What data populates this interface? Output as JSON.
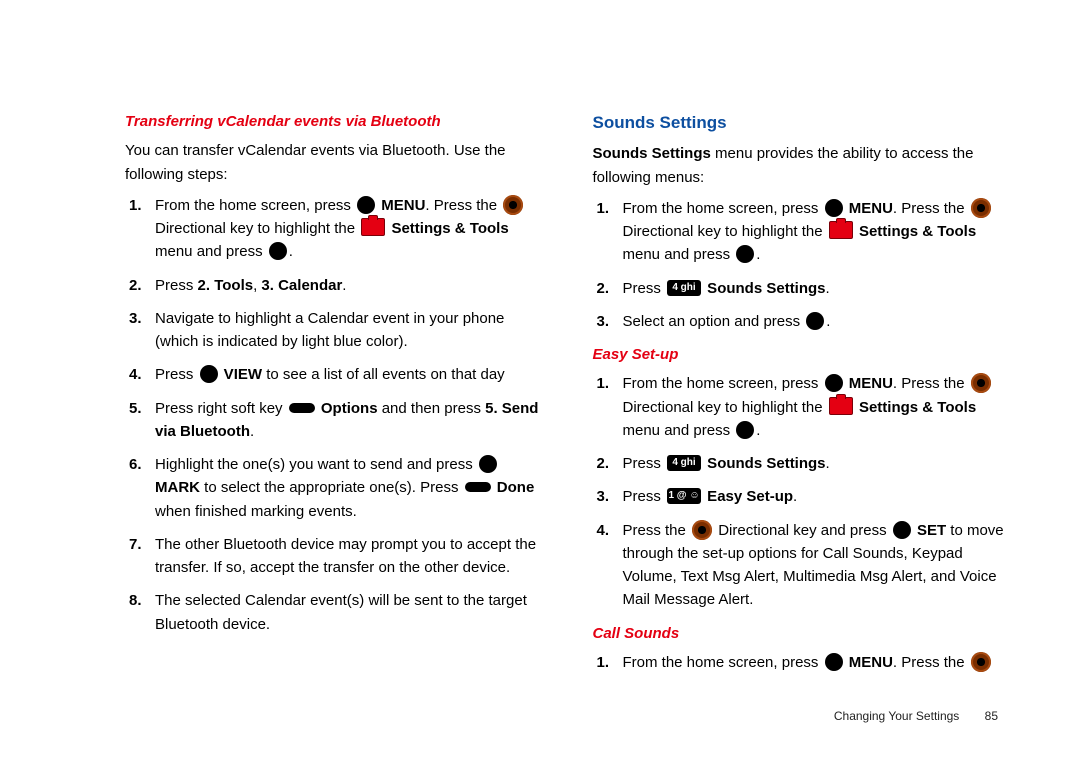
{
  "left": {
    "heading": "Transferring vCalendar events via Bluetooth",
    "intro": "You can transfer vCalendar events via Bluetooth. Use the following steps:",
    "s1_a": "From the home screen, press ",
    "s1_menu": " MENU",
    "s1_b": ". Press the ",
    "s1_c": "Directional key to highlight the ",
    "s1_tools": " Settings & Tools",
    "s1_d": " menu and press ",
    "s1_e": ".",
    "s2_a": "Press ",
    "s2_b": "2. Tools",
    "s2_c": ", ",
    "s2_d": "3. Calendar",
    "s2_e": ".",
    "s3": "Navigate to highlight a Calendar event in your phone (which is indicated by light blue color).",
    "s4_a": "Press ",
    "s4_view": " VIEW",
    "s4_b": " to see a list of all events on that day",
    "s5_a": "Press right soft key ",
    "s5_opt": " Options",
    "s5_b": " and then press ",
    "s5_c": "5. Send via Bluetooth",
    "s5_d": ".",
    "s6_a": "Highlight the one(s) you want to send and press ",
    "s6_mark": " MARK",
    "s6_b": " to select the appropriate one(s). Press ",
    "s6_done": " Done",
    "s6_c": " when finished marking events.",
    "s7": "The other Bluetooth device may prompt you to accept the transfer. If so, accept the transfer on the other device.",
    "s8": "The selected Calendar event(s) will be sent to the target Bluetooth device."
  },
  "right": {
    "heading": "Sounds Settings",
    "intro_a": "Sounds Settings",
    "intro_b": " menu provides the ability to access the following menus:",
    "s1_a": "From the home screen, press ",
    "s1_menu": " MENU",
    "s1_b": ". Press the ",
    "s1_c": "Directional key to highlight the ",
    "s1_tools": " Settings & Tools",
    "s1_d": " menu and press ",
    "s1_e": ".",
    "s2_a": "Press ",
    "s2_key": "4 ghi",
    "s2_b": " Sounds Settings",
    "s2_c": ".",
    "s3_a": "Select an option and press ",
    "s3_b": ".",
    "easy_heading": "Easy Set-up",
    "e1_a": "From the home screen, press ",
    "e1_menu": " MENU",
    "e1_b": ". Press the ",
    "e1_c": "Directional key to highlight the ",
    "e1_tools": " Settings & Tools",
    "e1_d": " menu and press ",
    "e1_e": ".",
    "e2_a": "Press ",
    "e2_key": "4 ghi",
    "e2_b": " Sounds Settings",
    "e2_c": ".",
    "e3_a": "Press ",
    "e3_key": "1 @ ☺",
    "e3_b": " Easy Set-up",
    "e3_c": ".",
    "e4_a": "Press the ",
    "e4_b": " Directional key and press ",
    "e4_set": " SET",
    "e4_c": " to move through the set-up options for Call Sounds, Keypad Volume, Text Msg Alert, Multimedia Msg Alert, and Voice Mail Message Alert.",
    "call_heading": "Call Sounds",
    "c1_a": "From the home screen, press ",
    "c1_menu": " MENU",
    "c1_b": ". Press the "
  },
  "footer": {
    "section": "Changing Your Settings",
    "page": "85"
  }
}
